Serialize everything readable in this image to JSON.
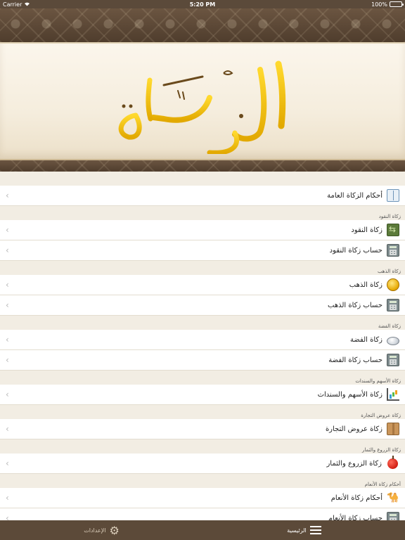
{
  "status_bar": {
    "carrier": "Carrier",
    "time": "5:20 PM",
    "battery": "100%",
    "battery_level": 1.0
  },
  "header": {
    "logo_text": "الزكاة"
  },
  "sections": [
    {
      "title": "",
      "items": [
        {
          "label": "أحكام الزكاة العامة",
          "icon": "book-icon"
        }
      ]
    },
    {
      "title": "زكاة النقود",
      "items": [
        {
          "label": "زكاة النقود",
          "icon": "money-icon"
        },
        {
          "label": "حساب زكاة النقود",
          "icon": "calculator-icon"
        }
      ]
    },
    {
      "title": "زكاة الذهب",
      "items": [
        {
          "label": "زكاة الذهب",
          "icon": "gold-coins-icon"
        },
        {
          "label": "حساب زكاة الذهب",
          "icon": "calculator-icon"
        }
      ]
    },
    {
      "title": "زكاة الفضة",
      "items": [
        {
          "label": "زكاة الفضة",
          "icon": "silver-icon"
        },
        {
          "label": "حساب زكاة الفضة",
          "icon": "calculator-icon"
        }
      ]
    },
    {
      "title": "زكاة الأسهم والسندات",
      "items": [
        {
          "label": "زكاة الأسهم والسندات",
          "icon": "chart-icon"
        }
      ]
    },
    {
      "title": "زكاة عروض التجارة",
      "items": [
        {
          "label": "زكاة عروض التجارة",
          "icon": "box-icon"
        }
      ]
    },
    {
      "title": "زكاة الزروع والثمار",
      "items": [
        {
          "label": "زكاة الزروع والثمار",
          "icon": "apple-icon"
        }
      ]
    },
    {
      "title": "أحكام زكاة الأنعام",
      "items": [
        {
          "label": "أحكام زكاة الأنعام",
          "icon": "camel-icon"
        },
        {
          "label": "حساب زكاة الأنعام",
          "icon": "calculator-icon"
        }
      ]
    }
  ],
  "tabbar": {
    "home_label": "الرئيسية",
    "settings_label": "الإعدادات"
  },
  "colors": {
    "brand": "#5c4a39",
    "accent_gold": "#e8b800",
    "background": "#f2ede3"
  }
}
